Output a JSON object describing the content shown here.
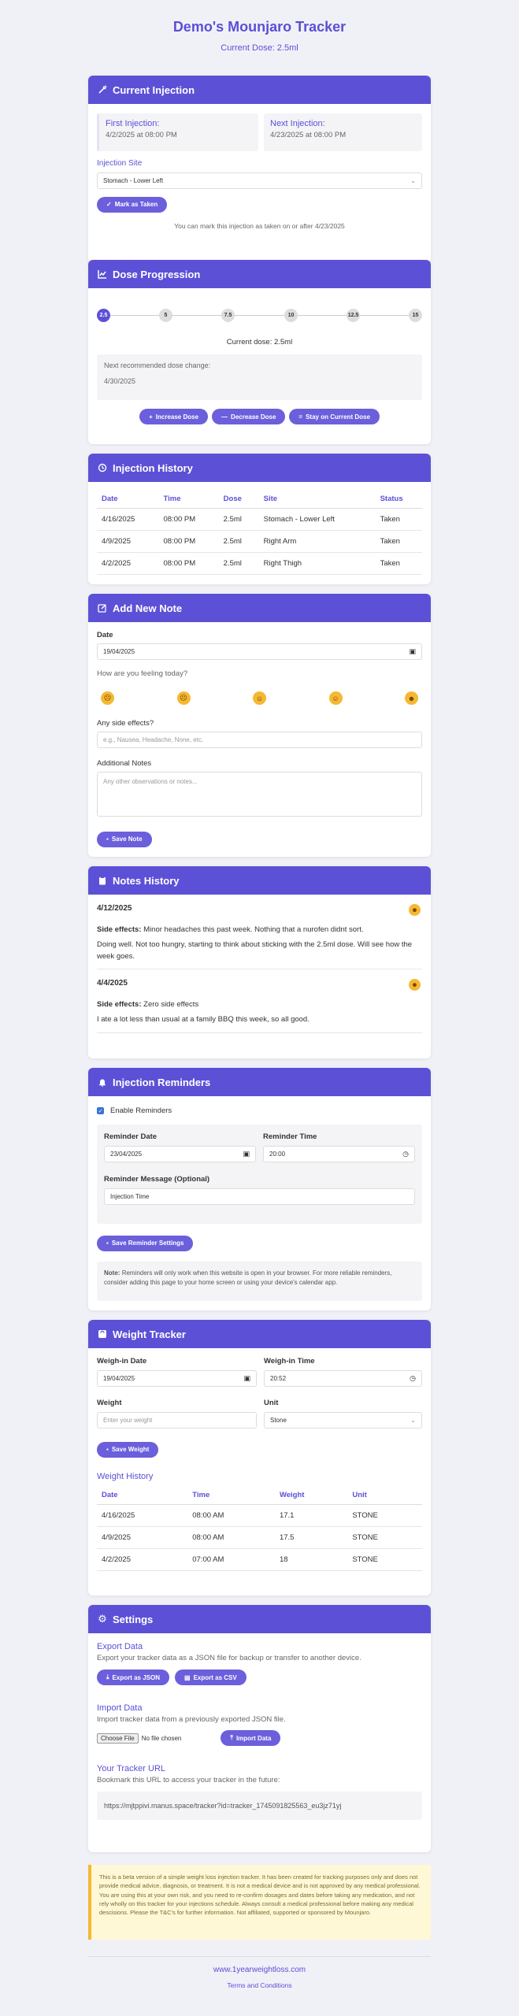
{
  "header": {
    "title": "Demo's Mounjaro Tracker",
    "current_dose": "Current Dose: 2.5ml"
  },
  "current_injection": {
    "title": "Current Injection",
    "first_label": "First Injection:",
    "first_value": "4/2/2025 at 08:00 PM",
    "next_label": "Next Injection:",
    "next_value": "4/23/2025 at 08:00 PM",
    "site_label": "Injection Site",
    "site_value": "Stomach - Lower Left",
    "mark_button": "Mark as Taken",
    "note": "You can mark this injection as taken on or after 4/23/2025"
  },
  "dose_progression": {
    "title": "Dose Progression",
    "steps": [
      "2.5",
      "5",
      "7.5",
      "10",
      "12.5",
      "15"
    ],
    "active_index": 0,
    "current": "Current dose: 2.5ml",
    "next_label": "Next recommended dose change:",
    "next_date": "4/30/2025",
    "increase": "Increase Dose",
    "decrease": "Decrease Dose",
    "stay": "Stay on Current Dose"
  },
  "injection_history": {
    "title": "Injection History",
    "headers": [
      "Date",
      "Time",
      "Dose",
      "Site",
      "Status"
    ],
    "rows": [
      [
        "4/16/2025",
        "08:00 PM",
        "2.5ml",
        "Stomach - Lower Left",
        "Taken"
      ],
      [
        "4/9/2025",
        "08:00 PM",
        "2.5ml",
        "Right Arm",
        "Taken"
      ],
      [
        "4/2/2025",
        "08:00 PM",
        "2.5ml",
        "Right Thigh",
        "Taken"
      ]
    ]
  },
  "add_note": {
    "title": "Add New Note",
    "date_label": "Date",
    "date_value": "19/04/2025",
    "feeling_label": "How are you feeling today?",
    "side_label": "Any side effects?",
    "side_placeholder": "e.g., Nausea, Headache, None, etc.",
    "additional_label": "Additional Notes",
    "additional_placeholder": "Any other observations or notes...",
    "save": "Save Note"
  },
  "notes_history": {
    "title": "Notes History",
    "side_prefix": "Side effects:",
    "notes": [
      {
        "date": "4/12/2025",
        "side": "Minor headaches this past week. Nothing that a nurofen didnt sort.",
        "text": "Doing well. Not too hungry, starting to think about sticking with the 2.5ml dose. Will see how the week goes."
      },
      {
        "date": "4/4/2025",
        "side": "Zero side effects",
        "text": "I ate a lot less than usual at a family BBQ this week, so all good."
      }
    ]
  },
  "reminders": {
    "title": "Injection Reminders",
    "enable": "Enable Reminders",
    "date_label": "Reminder Date",
    "date_value": "23/04/2025",
    "time_label": "Reminder Time",
    "time_value": "20:00",
    "message_label": "Reminder Message (Optional)",
    "message_value": "Injection Time",
    "save": "Save Reminder Settings",
    "note_bold": "Note:",
    "note_text": "Reminders will only work when this website is open in your browser. For more reliable reminders, consider adding this page to your home screen or using your device's calendar app."
  },
  "weight": {
    "title": "Weight Tracker",
    "date_label": "Weigh-in Date",
    "date_value": "19/04/2025",
    "time_label": "Weigh-in Time",
    "time_value": "20:52",
    "weight_label": "Weight",
    "weight_placeholder": "Enter your weight",
    "unit_label": "Unit",
    "unit_value": "Stone",
    "save": "Save Weight",
    "history_title": "Weight History",
    "headers": [
      "Date",
      "Time",
      "Weight",
      "Unit"
    ],
    "rows": [
      [
        "4/16/2025",
        "08:00 AM",
        "17.1",
        "STONE"
      ],
      [
        "4/9/2025",
        "08:00 AM",
        "17.5",
        "STONE"
      ],
      [
        "4/2/2025",
        "07:00 AM",
        "18",
        "STONE"
      ]
    ]
  },
  "settings": {
    "title": "Settings",
    "export_title": "Export Data",
    "export_desc": "Export your tracker data as a JSON file for backup or transfer to another device.",
    "export_json": "Export as JSON",
    "export_csv": "Export as CSV",
    "import_title": "Import Data",
    "import_desc": "Import tracker data from a previously exported JSON file.",
    "choose_file": "Choose File",
    "no_file": "No file chosen",
    "import_btn": "Import Data",
    "url_title": "Your Tracker URL",
    "url_desc": "Bookmark this URL to access your tracker in the future:",
    "url": "https://mjtppivi.manus.space/tracker?id=tracker_1745091825563_eu3jz71yj"
  },
  "disclaimer": "This is a beta version of a simple weight loss injection tracker. It has been created for tracking purposes only and does not provide medical advice, diagnosis, or treatment. It is not a medical device and is not approved by any medical professional. You are using this at your own risk, and you need to re-confirm dosages and dates before taking any medication, and not rely wholly on this tracker for your injections schedule. Always consult a medical professional before making any medical descisions. Please the T&C's for further information. Not affiliated, supported or sponsored by Mounjaro.",
  "footer": {
    "site": "www.1yearweightloss.com",
    "terms": "Terms and Conditions"
  }
}
